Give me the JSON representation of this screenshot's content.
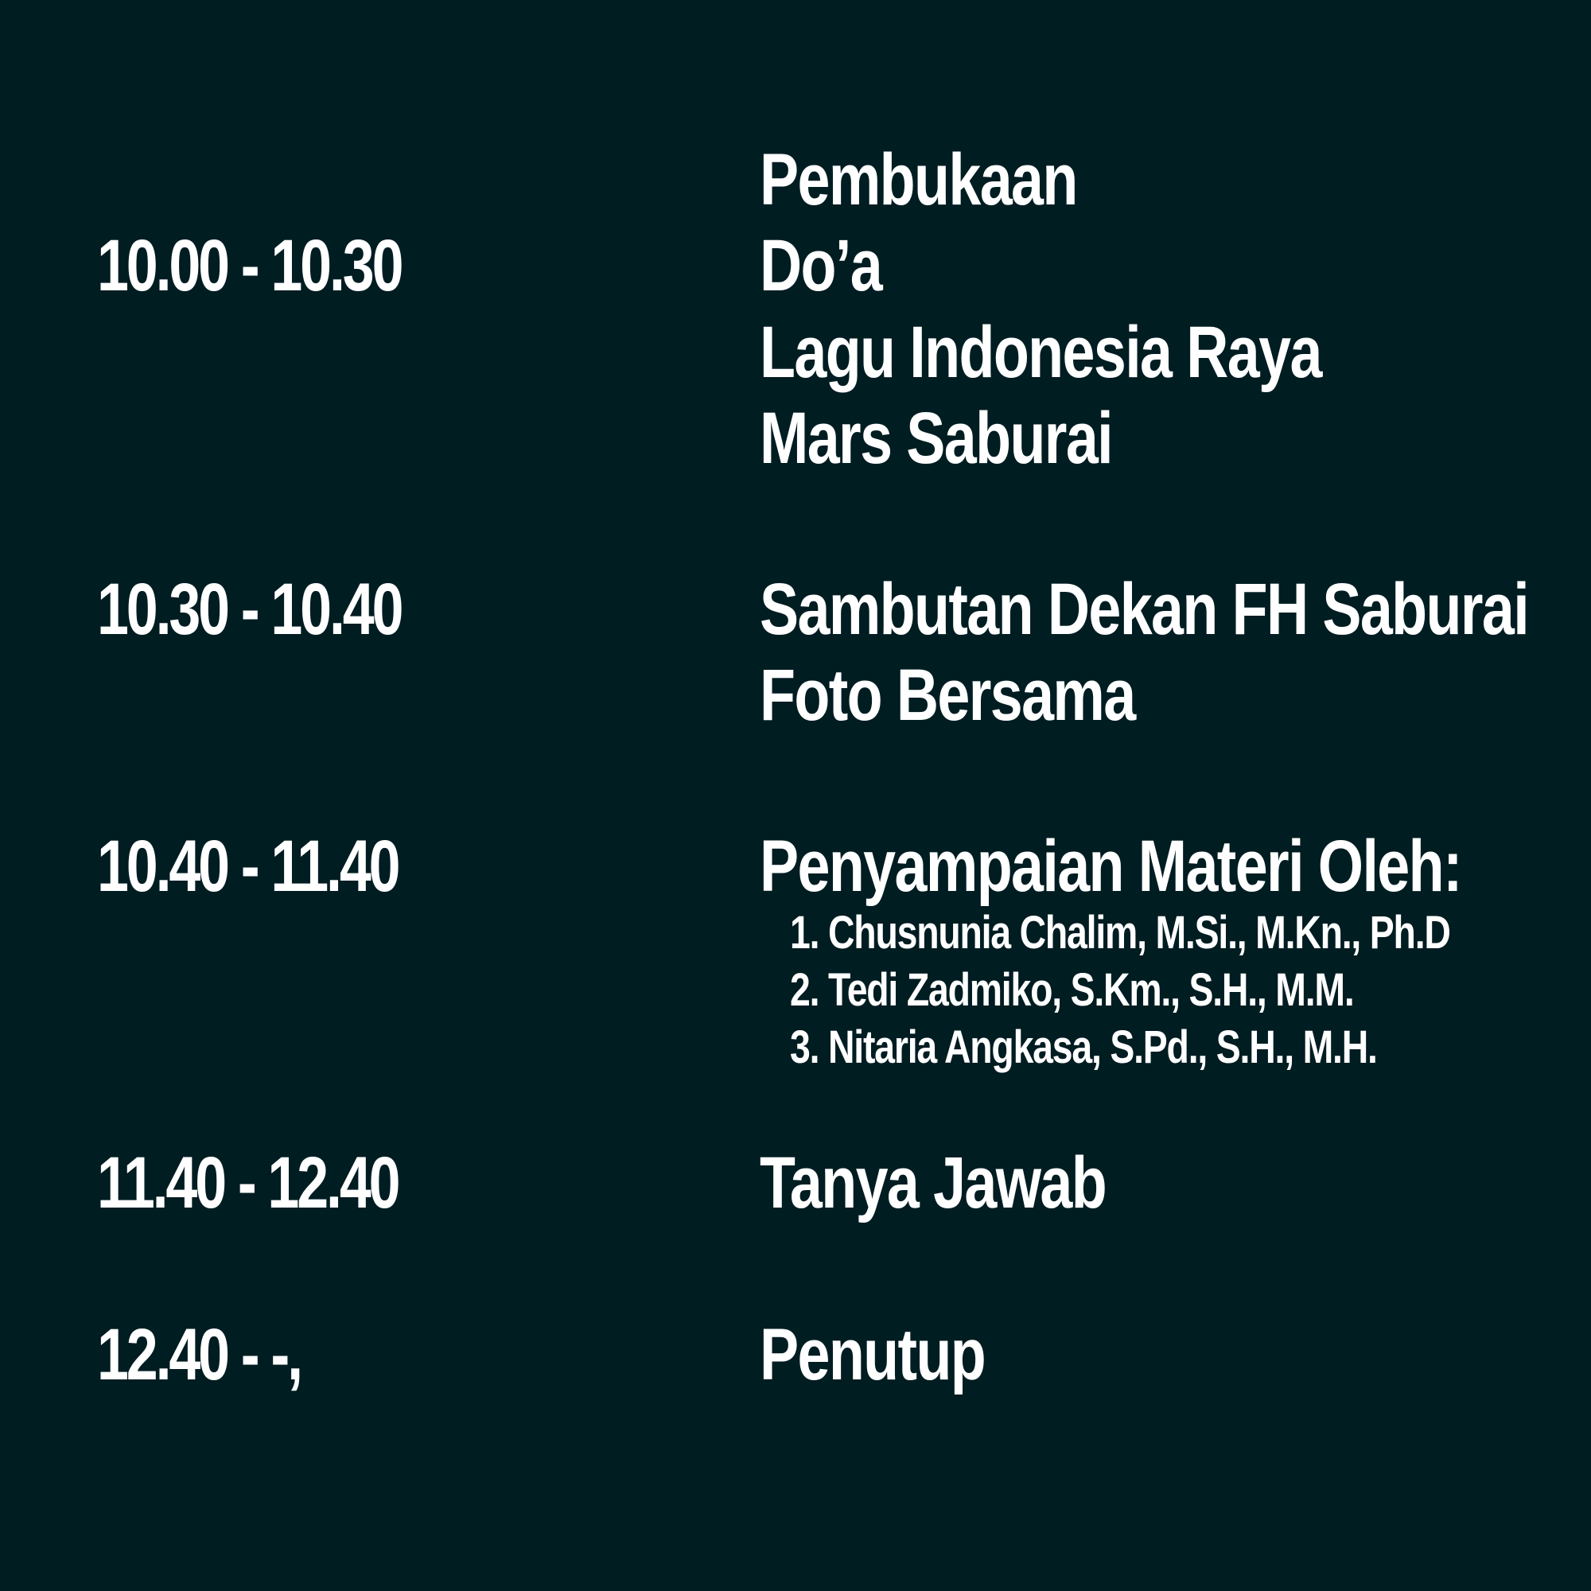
{
  "colors": {
    "background": "#001d22",
    "text": "#ffffff"
  },
  "schedule": [
    {
      "time": "10.00 - 10.30",
      "items": [
        "Pembukaan",
        "Do’a",
        "Lagu Indonesia Raya",
        "Mars Saburai"
      ]
    },
    {
      "time": "10.30 - 10.40",
      "items": [
        "Sambutan Dekan FH Saburai",
        "Foto Bersama"
      ]
    },
    {
      "time": "10.40 - 11.40",
      "items": [
        "Penyampaian Materi Oleh:"
      ],
      "speakers": [
        "1. Chusnunia Chalim, M.Si., M.Kn., Ph.D",
        "2. Tedi Zadmiko, S.Km., S.H., M.M.",
        "3. Nitaria Angkasa, S.Pd., S.H., M.H."
      ]
    },
    {
      "time": "11.40 - 12.40",
      "items": [
        "Tanya Jawab"
      ]
    },
    {
      "time": "12.40 - -,",
      "items": [
        "Penutup"
      ]
    }
  ]
}
